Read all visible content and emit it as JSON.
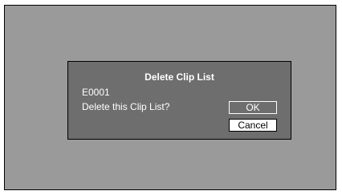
{
  "dialog": {
    "title": "Delete Clip List",
    "clip_id": "E0001",
    "message": "Delete this Clip List?",
    "ok_label": "OK",
    "cancel_label": "Cancel",
    "focused_button": "Cancel"
  },
  "colors": {
    "screen_background": "#9a9a9a",
    "dialog_background": "#6e6e6e",
    "text": "#ffffff",
    "focused_button_background": "#ffffff"
  }
}
